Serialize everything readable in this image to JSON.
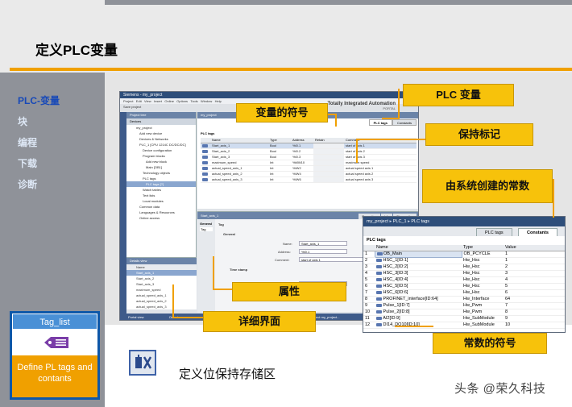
{
  "slide": {
    "title": "定义PLC变量",
    "nav": [
      {
        "label": "PLC-变量",
        "active": true
      },
      {
        "label": "块",
        "active": false
      },
      {
        "label": "编程",
        "active": false
      },
      {
        "label": "下载",
        "active": false
      },
      {
        "label": "诊断",
        "active": false
      }
    ],
    "tile": {
      "header": "Tag_list",
      "footer": "Define PL tags and contants"
    },
    "bottom_text": "定义位保持存储区",
    "watermark": "头条 @荣久科技"
  },
  "callouts": {
    "plc_tags": "PLC 变量",
    "symbol": "变量的符号",
    "retain": "保持标记",
    "constants": "由系统创建的常数",
    "properties": "属性",
    "detail": "详细界面",
    "const_symbol": "常数的符号"
  },
  "tia": {
    "window_title": "Siemens - my_project",
    "menu": [
      "Project",
      "Edit",
      "View",
      "Insert",
      "Online",
      "Options",
      "Tools",
      "Window",
      "Help"
    ],
    "toolbar_label": "Save project",
    "brand": "Totally Integrated Automation",
    "portal": "PORTAL",
    "project_tree_title": "Project tree",
    "devices_tab": "Devices",
    "tree": [
      "my_project",
      "Add new device",
      "Devices & Networks",
      "PLC_1 [CPU 1214C DC/DC/DC]",
      "Device configuration",
      "Program blocks",
      "Add new block",
      "Main [OB1]",
      "Technology objects",
      "PLC tags",
      "PLC tags [?]",
      "Watch tables",
      "Text lists",
      "Local modules",
      "Common data",
      "Languages & Resources",
      "Online access"
    ],
    "details_title": "Details view",
    "details_header": "Name",
    "details_rows": [
      "Start_axis_1",
      "Start_axis_2",
      "Start_axis_3",
      "maximum_speed",
      "actual_speed_axis_1",
      "actual_speed_axis_2",
      "actual_speed_axis_3"
    ],
    "editor_title": "my_project",
    "editor_tabs": [
      "PLC tags",
      "Constants"
    ],
    "editor_sub": "PLC tags",
    "tag_headers": [
      "",
      "Name",
      "Type",
      "Address",
      "Retain",
      "Comment"
    ],
    "tag_rows": [
      {
        "name": "Start_axis_1",
        "type": "Bool",
        "addr": "%I0.1",
        "comment": "start of axis 1"
      },
      {
        "name": "Start_axis_2",
        "type": "Bool",
        "addr": "%I0.2",
        "comment": "start of axis 2"
      },
      {
        "name": "Start_axis_3",
        "type": "Bool",
        "addr": "%I0.3",
        "comment": "start of axis 3"
      },
      {
        "name": "maximum_speed",
        "type": "Int",
        "addr": "%MW10",
        "comment": "maximum speed"
      },
      {
        "name": "actual_speed_axis_1",
        "type": "Int",
        "addr": "%IW2",
        "comment": "actual speed axis 1"
      },
      {
        "name": "actual_speed_axis_2",
        "type": "Int",
        "addr": "%IW4",
        "comment": "actual speed axis 2"
      },
      {
        "name": "actual_speed_axis_3",
        "type": "Int",
        "addr": "%IW6",
        "comment": "actual speed axis 3"
      }
    ],
    "props_title": "Start_axis_1",
    "props_tabs": [
      "Properties",
      "Info",
      "Diagnostics"
    ],
    "props_left": [
      "General",
      "Tag"
    ],
    "props_section": "Tag",
    "props_group": "General",
    "prop_name_label": "Name:",
    "prop_name": "Start_axis_1",
    "prop_addr_label": "Address:",
    "prop_addr": "%I0.1",
    "prop_comment_label": "Comment:",
    "prop_comment": "start of axis 1",
    "prop_datatype_label": "Data type:",
    "timestamp_label": "Time stamp",
    "date_created_label": "Date created:",
    "date_created": "2/27/2009 1:03 PM",
    "last_modified_label": "Last modified:",
    "status_portal": "Portal view",
    "status_overview": "Overview",
    "status_msg": "The project my_project..."
  },
  "constants": {
    "breadcrumb": [
      "my_project",
      "PLC_1",
      "PLC tags"
    ],
    "tabs": [
      "PLC tags",
      "Constants"
    ],
    "subtitle": "PLC tags",
    "headers": [
      "",
      "Name",
      "Type",
      "Value"
    ],
    "rows": [
      {
        "n": "1",
        "name": "OB_Main",
        "type": "OB_PCYCLE",
        "value": "1"
      },
      {
        "n": "2",
        "name": "HSC_1[ID:1]",
        "type": "Hw_Hsc",
        "value": "1"
      },
      {
        "n": "3",
        "name": "HSC_2[ID:2]",
        "type": "Hw_Hsc",
        "value": "2"
      },
      {
        "n": "4",
        "name": "HSC_3[ID:3]",
        "type": "Hw_Hsc",
        "value": "3"
      },
      {
        "n": "5",
        "name": "HSC_4[ID:4]",
        "type": "Hw_Hsc",
        "value": "4"
      },
      {
        "n": "6",
        "name": "HSC_5[ID:5]",
        "type": "Hw_Hsc",
        "value": "5"
      },
      {
        "n": "7",
        "name": "HSC_6[ID:6]",
        "type": "Hw_Hsc",
        "value": "6"
      },
      {
        "n": "8",
        "name": "PROFINET_interface[ID:64]",
        "type": "Hw_Interface",
        "value": "64"
      },
      {
        "n": "9",
        "name": "Pulse_1[ID:7]",
        "type": "Hw_Pwm",
        "value": "7"
      },
      {
        "n": "10",
        "name": "Pulse_2[ID:8]",
        "type": "Hw_Pwm",
        "value": "8"
      },
      {
        "n": "11",
        "name": "AI2[ID:9]",
        "type": "Hw_SubModule",
        "value": "9"
      },
      {
        "n": "12",
        "name": "DI14_DO10[ID:10]",
        "type": "Hw_SubModule",
        "value": "10"
      }
    ]
  },
  "colors": {
    "accent": "#f0a000",
    "callout": "#f7c20b",
    "nav_active": "#1849b8",
    "title_bar": "#2e4e7a"
  }
}
